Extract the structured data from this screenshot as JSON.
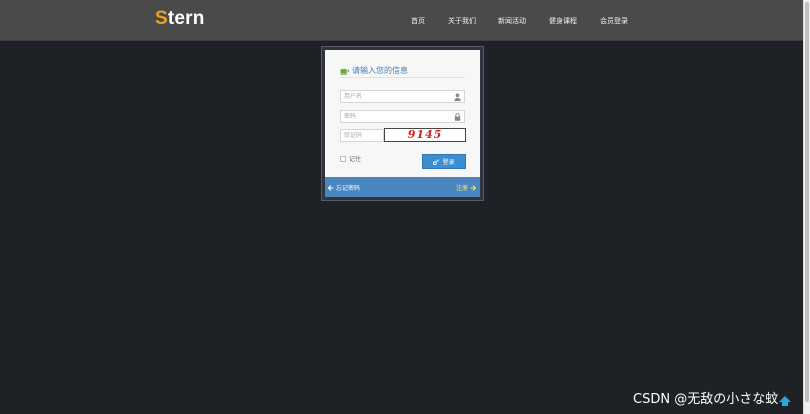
{
  "brand": {
    "first_letter": "S",
    "rest": "tern"
  },
  "nav": {
    "items": [
      {
        "label": "首页"
      },
      {
        "label": "关于我们"
      },
      {
        "label": "新闻活动"
      },
      {
        "label": "健身课程"
      },
      {
        "label": "会员登录"
      }
    ]
  },
  "login": {
    "title": "请输入您的信息",
    "username_placeholder": "用户名",
    "password_placeholder": "密码",
    "captcha_placeholder": "验证码",
    "captcha_text": "9145",
    "remember_label": "记住",
    "submit_label": "登录",
    "forgot_label": "忘记密码",
    "register_label": "注册"
  },
  "watermark": "CSDN @无敌の小さな蚊",
  "colors": {
    "accent": "#3d8ed0",
    "brand_orange": "#f0a020",
    "register_yellow": "#f5e56b",
    "captcha_red": "#d42020"
  }
}
